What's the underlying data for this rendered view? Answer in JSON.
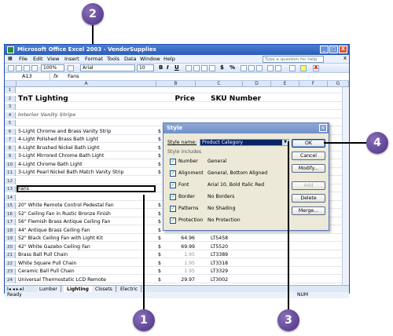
{
  "window": {
    "title": "Microsoft Office Excel 2003 - VendorSupplies",
    "controls": [
      "_",
      "□",
      "X"
    ]
  },
  "menu": {
    "items": [
      "File",
      "Edit",
      "View",
      "Insert",
      "Format",
      "Tools",
      "Data",
      "Window",
      "Help"
    ],
    "help_placeholder": "Type a question for help",
    "close": "x"
  },
  "toolbar": {
    "zoom": "100%",
    "font": "Arial",
    "font_size": "10",
    "bold": "B",
    "italic": "I",
    "underline": "U",
    "currency": "$",
    "percent": "%"
  },
  "formula_bar": {
    "name_box": "A13",
    "fx": "fx",
    "content": "Fans"
  },
  "columns": [
    "A",
    "B",
    "C",
    "D",
    "E",
    "F",
    "G"
  ],
  "rows": [
    {
      "num": "1",
      "a": "",
      "dollar": "",
      "price": "",
      "sku": ""
    },
    {
      "num": "2",
      "a": "TnT Lighting",
      "dollar": "",
      "price": "Price",
      "sku": "SKU Number",
      "style": "big"
    },
    {
      "num": "3",
      "a": "",
      "dollar": "",
      "price": "",
      "sku": ""
    },
    {
      "num": "4",
      "a": "Interior Vanity Strips",
      "dollar": "",
      "price": "",
      "sku": "",
      "style": "subhead"
    },
    {
      "num": "5",
      "a": "",
      "dollar": "",
      "price": "",
      "sku": ""
    },
    {
      "num": "6",
      "a": "5-Light Chrome and Brass Vanity Strip",
      "dollar": "$",
      "price": "",
      "sku": ""
    },
    {
      "num": "7",
      "a": "4-Light Polished Brass Bath Light",
      "dollar": "$",
      "price": "",
      "sku": ""
    },
    {
      "num": "8",
      "a": "4-Light Brushed Nickel Bath Light",
      "dollar": "$",
      "price": "",
      "sku": ""
    },
    {
      "num": "9",
      "a": "3-Light Mirrored Chrome Bath Light",
      "dollar": "$",
      "price": "",
      "sku": ""
    },
    {
      "num": "10",
      "a": "4-Light Chrome Bath Light",
      "dollar": "$",
      "price": "",
      "sku": ""
    },
    {
      "num": "11",
      "a": "3-Light Pearl Nickel Bath Match Vanity Strip",
      "dollar": "$",
      "price": "",
      "sku": ""
    },
    {
      "num": "12",
      "a": "",
      "dollar": "",
      "price": "",
      "sku": ""
    },
    {
      "num": "13",
      "a": "Fans",
      "dollar": "",
      "price": "",
      "sku": "",
      "style": "selected"
    },
    {
      "num": "14",
      "a": "",
      "dollar": "",
      "price": "",
      "sku": ""
    },
    {
      "num": "15",
      "a": "20\" White Remote Control Pedestal Fan",
      "dollar": "$",
      "price": "",
      "sku": ""
    },
    {
      "num": "16",
      "a": "52\" Ceiling Fan in Rustic Bronze Finish",
      "dollar": "$",
      "price": "",
      "sku": ""
    },
    {
      "num": "17",
      "a": "56\" Flemish Brass Antique Ceiling Fan",
      "dollar": "$",
      "price": "",
      "sku": ""
    },
    {
      "num": "18",
      "a": "44\" Antique Brass Ceiling Fan",
      "dollar": "$",
      "price": "",
      "sku": ""
    },
    {
      "num": "19",
      "a": "52\" Black Ceiling Fan with Light Kit",
      "dollar": "$",
      "price": "64.96",
      "sku": "LT5458"
    },
    {
      "num": "20",
      "a": "42\" White Gazebo Ceiling Fan",
      "dollar": "$",
      "price": "69.99",
      "sku": "LT5520"
    },
    {
      "num": "21",
      "a": "Brass Ball Pull Chain",
      "dollar": "$",
      "price": "1.95",
      "sku": "LT3389",
      "style": "grayprice"
    },
    {
      "num": "22",
      "a": "White Square Pull Chain",
      "dollar": "$",
      "price": "1.95",
      "sku": "LT3318",
      "style": "grayprice"
    },
    {
      "num": "23",
      "a": "Ceramic Ball Pull Chain",
      "dollar": "$",
      "price": "1.95",
      "sku": "LT3329",
      "style": "grayprice"
    },
    {
      "num": "24",
      "a": "Universal Thermostatic LCD Remote",
      "dollar": "$",
      "price": "29.97",
      "sku": "LT3002"
    }
  ],
  "sheet_tabs": [
    "Lumber",
    "Lighting",
    "Closets",
    "Electric"
  ],
  "sheet_nav": "I◂ ◂ ▸ ▸I",
  "status": {
    "left": "Ready",
    "right": "NUM"
  },
  "dialog": {
    "title": "Style",
    "style_name_label": "Style name:",
    "style_name_value": "Product Category",
    "includes_label": "Style includes",
    "options": [
      {
        "label": "Number",
        "value": "General",
        "checked": true
      },
      {
        "label": "Alignment",
        "value": "General, Bottom Aligned",
        "checked": true
      },
      {
        "label": "Font",
        "value": "Arial 10, Bold Italic Red",
        "checked": true
      },
      {
        "label": "Border",
        "value": "No Borders",
        "checked": true
      },
      {
        "label": "Patterns",
        "value": "No Shading",
        "checked": true
      },
      {
        "label": "Protection",
        "value": "No Protection",
        "checked": true
      }
    ],
    "buttons": {
      "ok": "OK",
      "cancel": "Cancel",
      "modify": "Modify...",
      "add": "Add",
      "delete": "Delete",
      "merge": "Merge..."
    }
  },
  "callouts": [
    "1",
    "2",
    "3",
    "4"
  ]
}
